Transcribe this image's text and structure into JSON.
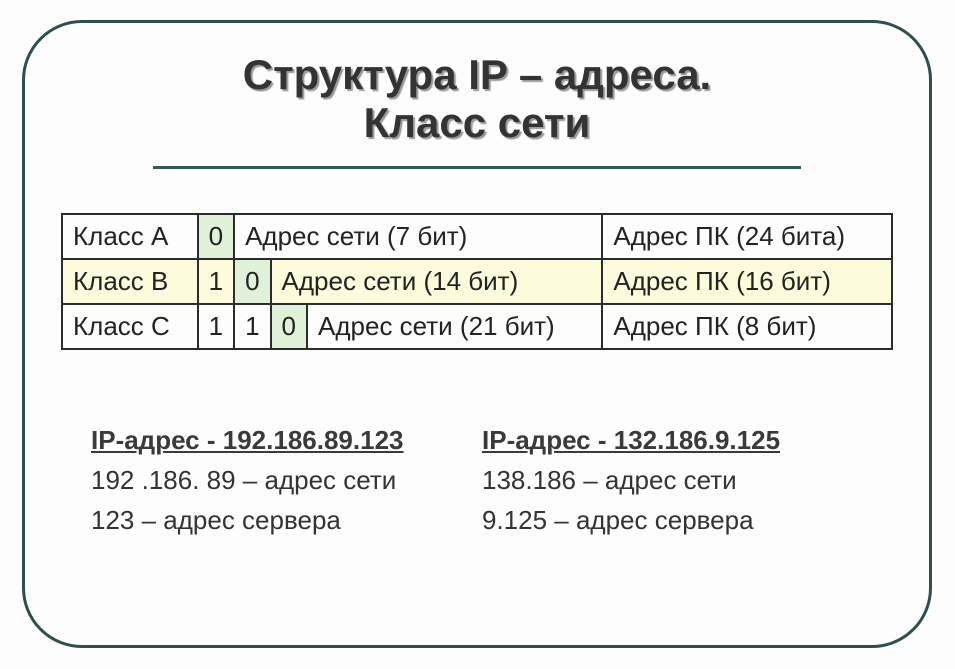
{
  "title": {
    "line1": "Структура IP – адреса.",
    "line2": "Класс сети"
  },
  "table": {
    "rowA": {
      "class_label": "Класс А",
      "b0": "0",
      "net": "Адрес сети (7 бит)",
      "host": "Адрес ПК (24 бита)"
    },
    "rowB": {
      "class_label": "Класс В",
      "b0": "1",
      "b1": "0",
      "net": "Адрес сети (14 бит)",
      "host": "Адрес ПК (16 бит)"
    },
    "rowC": {
      "class_label": "Класс С",
      "b0": "1",
      "b1": "1",
      "b2": "0",
      "net": "Адрес сети (21 бит)",
      "host": "Адрес ПК (8 бит)"
    }
  },
  "examples": {
    "left": {
      "head": "IP-адрес - 192.186.89.123",
      "net": "192 .186. 89 – адрес сети",
      "srv": "123 – адрес сервера"
    },
    "right": {
      "head": "IP-адрес - 132.186.9.125",
      "net": "138.186 – адрес сети",
      "srv": "9.125 – адрес сервера"
    }
  }
}
